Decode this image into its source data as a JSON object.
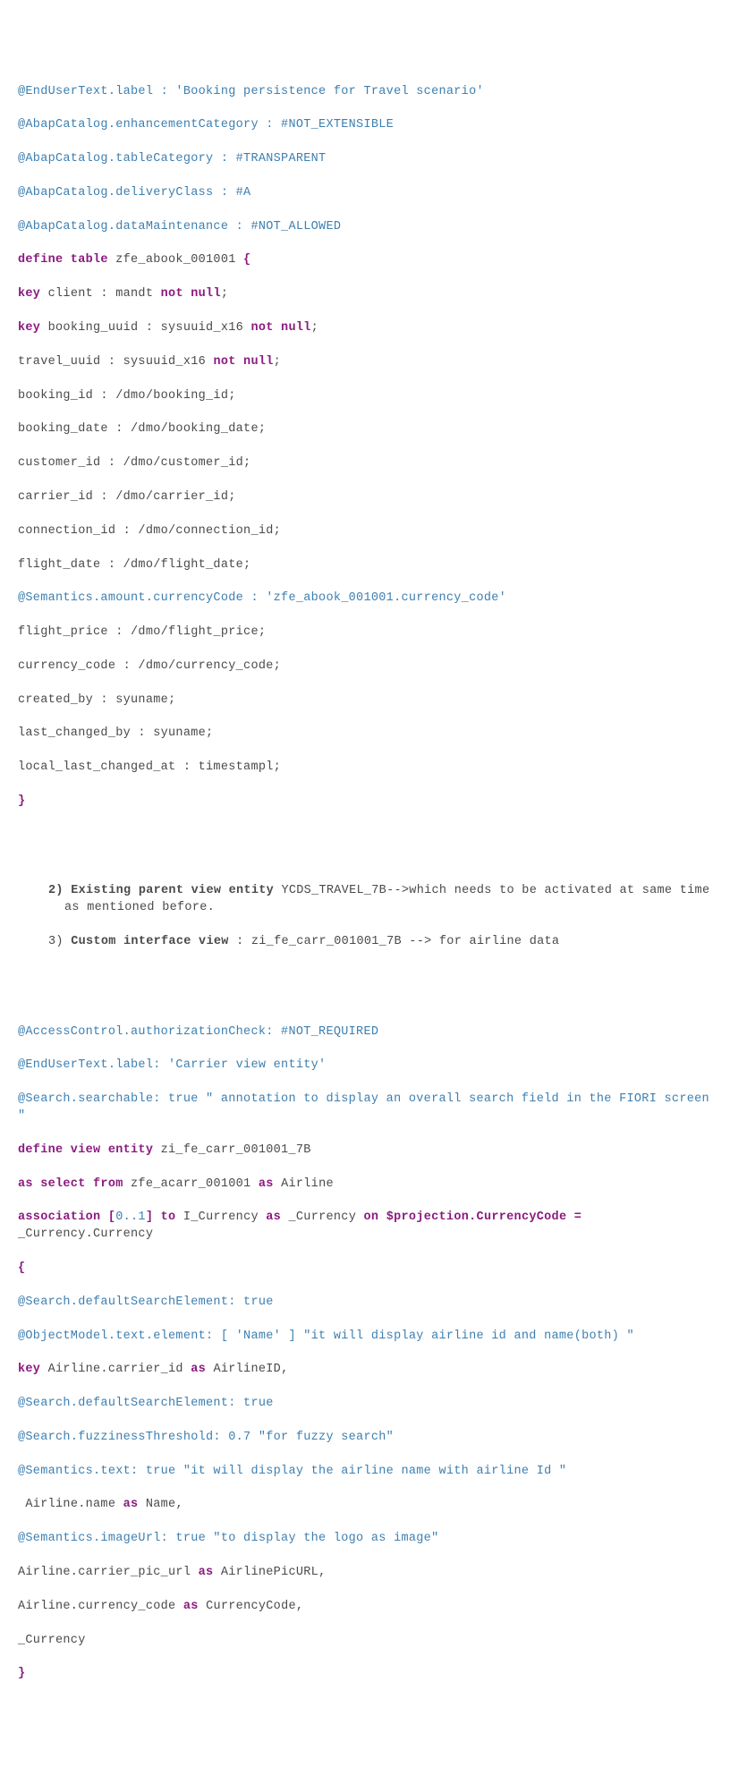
{
  "block1": {
    "l1": "@EndUserText.label : 'Booking persistence for Travel scenario'",
    "l2": "@AbapCatalog.enhancementCategory : #NOT_EXTENSIBLE",
    "l3": "@AbapCatalog.tableCategory : #TRANSPARENT",
    "l4": "@AbapCatalog.deliveryClass : #A",
    "l5": "@AbapCatalog.dataMaintenance : #NOT_ALLOWED",
    "l6a": "define table ",
    "l6b": "zfe_abook_001001 ",
    "l6c": "{",
    "l7a": "key ",
    "l7b": "client : mandt ",
    "l7c": "not null",
    "l7d": ";",
    "l8a": "key ",
    "l8b": "booking_uuid : sysuuid_x16 ",
    "l8c": "not null",
    "l8d": ";",
    "l9a": "travel_uuid : sysuuid_x16 ",
    "l9b": "not null",
    "l9c": ";",
    "l10": "booking_id : /dmo/booking_id;",
    "l11": "booking_date : /dmo/booking_date;",
    "l12": "customer_id : /dmo/customer_id;",
    "l13": "carrier_id : /dmo/carrier_id;",
    "l14": "connection_id : /dmo/connection_id;",
    "l15": "flight_date : /dmo/flight_date;",
    "l16": "@Semantics.amount.currencyCode : 'zfe_abook_001001.currency_code'",
    "l17": "flight_price : /dmo/flight_price;",
    "l18": "currency_code : /dmo/currency_code;",
    "l19": "created_by : syuname;",
    "l20": "last_changed_by : syuname;",
    "l21": "local_last_changed_at : timestampl;",
    "l22": "}"
  },
  "list": {
    "i2a": "2) ",
    "i2b": "Existing parent view entity ",
    "i2c": "YCDS_TRAVEL_7B-->which needs to be activated at same time as mentioned before.",
    "i3a": "3) ",
    "i3b": "Custom interface view ",
    "i3c": ": zi_fe_carr_001001_7B --> for airline data"
  },
  "block2": {
    "l1": "@AccessControl.authorizationCheck: #NOT_REQUIRED",
    "l2": "@EndUserText.label: 'Carrier view entity'",
    "l3": "@Search.searchable: true \" annotation to display an overall search field in the FIORI screen \"",
    "l4a": "define view entity ",
    "l4b": "zi_fe_carr_001001_7B",
    "l5a": "as select from ",
    "l5b": "zfe_acarr_001001 ",
    "l5c": "as ",
    "l5d": "Airline",
    "l6a": "association [",
    "l6b": "0..1",
    "l6c": "] ",
    "l6d": "to ",
    "l6e": "I_Currency ",
    "l6f": "as ",
    "l6g": "_Currency ",
    "l6h": "on $projection",
    "l6i": ".CurrencyCode = ",
    "l6j": "_Currency.Currency",
    "l7": "{",
    "l8": "@Search.defaultSearchElement: true",
    "l9": "@ObjectModel.text.element: [ 'Name' ] \"it will display airline id and name(both) \"",
    "l10a": "key ",
    "l10b": "Airline.carrier_id ",
    "l10c": "as ",
    "l10d": "AirlineID,",
    "l11": "@Search.defaultSearchElement: true",
    "l12": "@Search.fuzzinessThreshold: 0.7 \"for fuzzy search\"",
    "l13": "@Semantics.text: true \"it will display the airline name with airline Id \"",
    "l14a": " Airline.name ",
    "l14b": "as ",
    "l14c": "Name,",
    "l15": "@Semantics.imageUrl: true \"to display the logo as image\"",
    "l16a": "Airline.carrier_pic_url ",
    "l16b": "as ",
    "l16c": "AirlinePicURL,",
    "l17a": "Airline.currency_code ",
    "l17b": "as ",
    "l17c": "CurrencyCode,",
    "l18": "_Currency",
    "l19": "}"
  }
}
